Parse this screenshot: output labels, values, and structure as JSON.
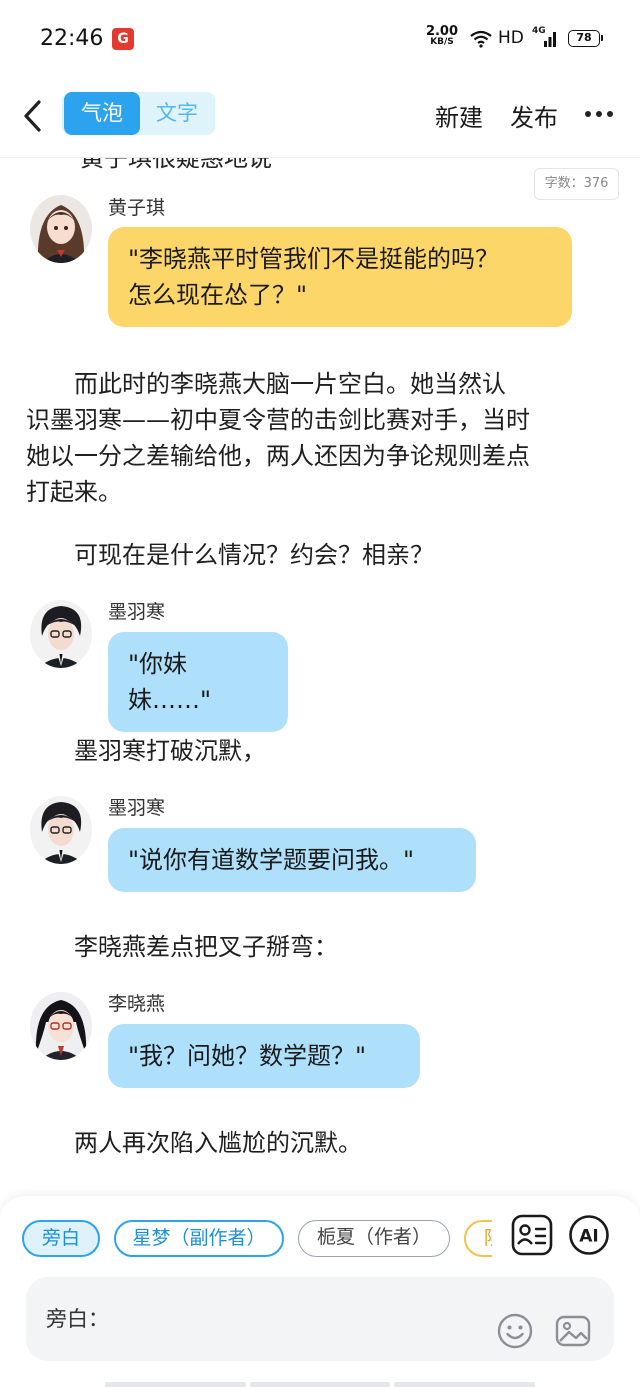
{
  "status_bar": {
    "time": "22:46",
    "app_icon_label": "G",
    "net_speed_value": "2.00",
    "net_speed_unit": "KB/S",
    "network_type": "HD",
    "signal_type": "4G",
    "battery": "78"
  },
  "toolbar": {
    "tabs": [
      {
        "label": "气泡",
        "active": true
      },
      {
        "label": "文字",
        "active": false
      }
    ],
    "new_label": "新建",
    "publish_label": "发布"
  },
  "content": {
    "partial_top_line": "黄子琪很疑惑地说",
    "word_count": "字数：376",
    "messages": [
      {
        "speaker": "黄子琪",
        "bubble_color": "#fdd66a",
        "lines": [
          "\"李晓燕平时管我们不是挺能的吗？",
          "怎么现在怂了？\""
        ]
      },
      {
        "speaker": "墨羽寒",
        "bubble_color": "#aee0fb",
        "lines": [
          "\"你妹妹……\""
        ]
      },
      {
        "speaker": "墨羽寒",
        "bubble_color": "#aee0fb",
        "lines": [
          "\"说你有道数学题要问我。\""
        ]
      },
      {
        "speaker": "李晓燕",
        "bubble_color": "#aee0fb",
        "lines": [
          "\"我？问她？数学题？\""
        ]
      }
    ],
    "narrations": [
      [
        "　　而此时的李晓燕大脑一片空白。她当然认",
        "识墨羽寒——初中夏令营的击剑比赛对手，当时",
        "她以一分之差输给他，两人还因为争论规则差点",
        "打起来。"
      ],
      [
        "　　可现在是什么情况？约会？相亲？"
      ],
      [
        "　　墨羽寒打破沉默，"
      ],
      [
        "　　李晓燕差点把叉子掰弯："
      ],
      [
        "　　两人再次陷入尴尬的沉默。"
      ]
    ]
  },
  "bottom": {
    "chips": [
      {
        "label": "旁白",
        "selected": true
      },
      {
        "label": "星梦（副作者）",
        "selected": false
      },
      {
        "label": "栀夏（作者）",
        "selected": false
      },
      {
        "label": "陨",
        "selected": false
      }
    ],
    "ai_label": "AI",
    "input_label": "旁白：",
    "input_value": ""
  },
  "colors": {
    "accent": "#2ba3ee",
    "bubble_yellow": "#fdd66a",
    "bubble_blue": "#aee0fb"
  }
}
